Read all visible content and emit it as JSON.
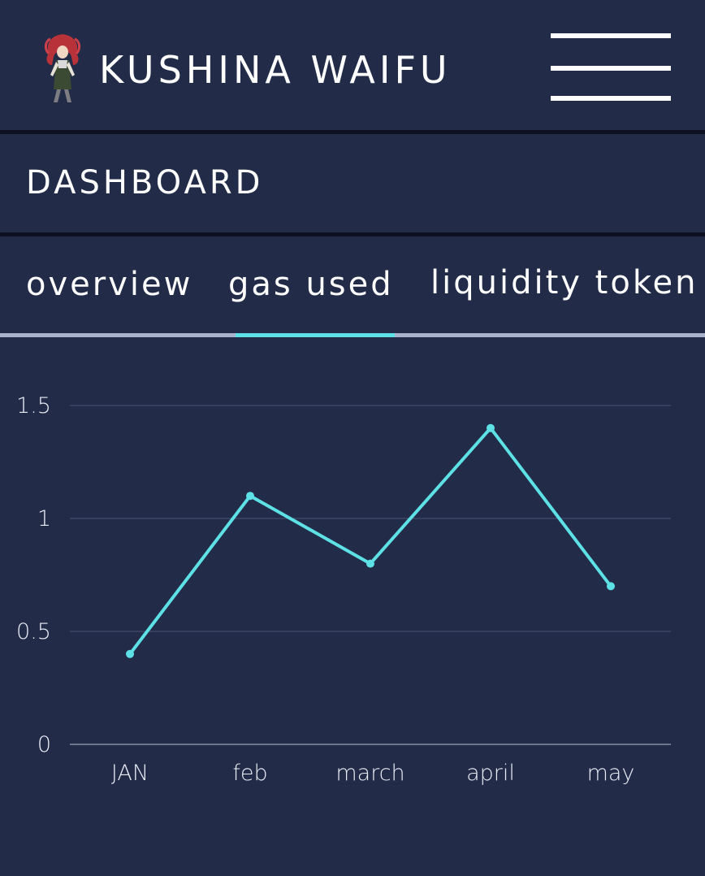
{
  "header": {
    "brand": "KUSHINA WAIFU",
    "logo_icon": "character-avatar-icon",
    "menu_icon": "hamburger-menu-icon"
  },
  "section": {
    "title": "DASHBOARD"
  },
  "tabs": [
    {
      "label": "overview",
      "active": false
    },
    {
      "label": "gas used",
      "active": true
    },
    {
      "label": "liquidity token",
      "active": false
    }
  ],
  "colors": {
    "background": "#222b47",
    "accent": "#5ee1e6",
    "divider": "#0d1020",
    "tab_baseline": "#a9b3cc"
  },
  "chart_data": {
    "type": "line",
    "categories": [
      "JAN",
      "feb",
      "march",
      "april",
      "may"
    ],
    "values": [
      0.4,
      1.1,
      0.8,
      1.4,
      0.7
    ],
    "y_ticks": [
      "0",
      "0.5",
      "1",
      "1.5"
    ],
    "ylim": [
      0,
      1.5
    ],
    "grid": true,
    "legend": "none"
  }
}
